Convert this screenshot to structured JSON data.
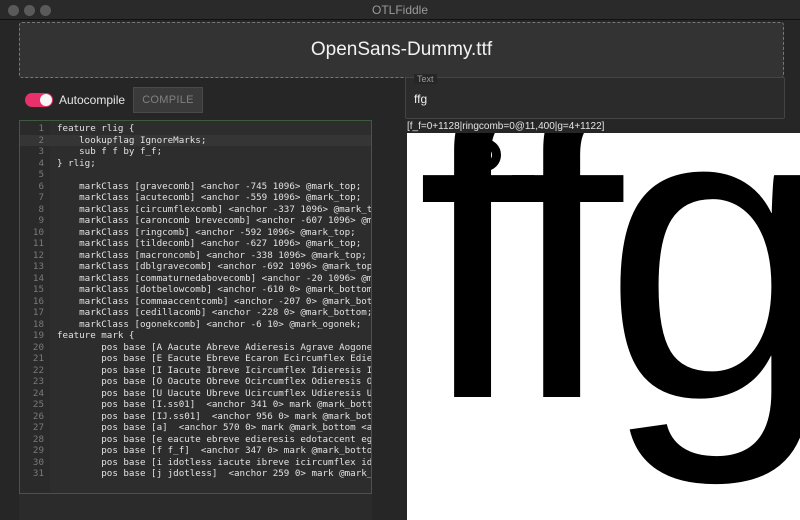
{
  "window": {
    "title": "OTLFiddle"
  },
  "drop_zone": {
    "filename": "OpenSans-Dummy.ttf"
  },
  "toolbar": {
    "autocompile_label": "Autocompile",
    "autocompile_on": true,
    "compile_label": "COMPILE"
  },
  "text_panel": {
    "legend": "Text",
    "value": "ffg"
  },
  "shaping_output": "[f_f=0+1128|ringcomb=0@11,400|g=4+1122]",
  "preview": {
    "glyph_text": "ffg"
  },
  "editor": {
    "active_line": 2,
    "lines": [
      {
        "n": "1",
        "text": "feature rlig {"
      },
      {
        "n": "2",
        "text": "    lookupflag IgnoreMarks;"
      },
      {
        "n": "3",
        "text": "    sub f f by f_f;"
      },
      {
        "n": "4",
        "text": "} rlig;"
      },
      {
        "n": "5",
        "text": ""
      },
      {
        "n": "6",
        "text": "    markClass [gravecomb] <anchor -745 1096> @mark_top;"
      },
      {
        "n": "7",
        "text": "    markClass [acutecomb] <anchor -559 1096> @mark_top;"
      },
      {
        "n": "8",
        "text": "    markClass [circumflexcomb] <anchor -337 1096> @mark_top;"
      },
      {
        "n": "9",
        "text": "    markClass [caroncomb brevecomb] <anchor -607 1096> @mark_"
      },
      {
        "n": "10",
        "text": "    markClass [ringcomb] <anchor -592 1096> @mark_top;"
      },
      {
        "n": "11",
        "text": "    markClass [tildecomb] <anchor -627 1096> @mark_top;"
      },
      {
        "n": "12",
        "text": "    markClass [macroncomb] <anchor -338 1096> @mark_top;"
      },
      {
        "n": "13",
        "text": "    markClass [dblgravecomb] <anchor -692 1096> @mark_top;"
      },
      {
        "n": "14",
        "text": "    markClass [commaturnedabovecomb] <anchor -20 1096> @mark_"
      },
      {
        "n": "15",
        "text": "    markClass [dotbelowcomb] <anchor -610 0> @mark_bottom;"
      },
      {
        "n": "16",
        "text": "    markClass [commaaccentcomb] <anchor -207 0> @mark_bottom;"
      },
      {
        "n": "17",
        "text": "    markClass [cedillacomb] <anchor -228 0> @mark_bottom;"
      },
      {
        "n": "18",
        "text": "    markClass [ogonekcomb] <anchor -6 10> @mark_ogonek;"
      },
      {
        "n": "19",
        "text": "feature mark {"
      },
      {
        "n": "20",
        "text": "        pos base [A Aacute Abreve Adieresis Agrave Aogonek Ar"
      },
      {
        "n": "21",
        "text": "        pos base [E Eacute Ebreve Ecaron Ecircumflex Edieresi"
      },
      {
        "n": "22",
        "text": "        pos base [I Iacute Ibreve Icircumflex Idieresis Idier"
      },
      {
        "n": "23",
        "text": "        pos base [O Oacute Obreve Ocircumflex Odieresis Ograv"
      },
      {
        "n": "24",
        "text": "        pos base [U Uacute Ubreve Ucircumflex Udieresis Ugrav"
      },
      {
        "n": "25",
        "text": "        pos base [I.ss01]  <anchor 341 0> mark @mark_bottom <"
      },
      {
        "n": "26",
        "text": "        pos base [IJ.ss01]  <anchor 956 0> mark @mark_bottom"
      },
      {
        "n": "27",
        "text": "        pos base [a]  <anchor 570 0> mark @mark_bottom <ancho"
      },
      {
        "n": "28",
        "text": "        pos base [e eacute ebreve edieresis edotaccent egrave"
      },
      {
        "n": "29",
        "text": "        pos base [f f_f]  <anchor 347 0> mark @mark_bottom <c"
      },
      {
        "n": "30",
        "text": "        pos base [i idotless iacute ibreve icircumflex idiere"
      },
      {
        "n": "31",
        "text": "        pos base [j jdotless]  <anchor 259 0> mark @mark_bott"
      }
    ]
  },
  "colors": {
    "accent": "#e8306a",
    "editor_border": "#3f5a3f"
  }
}
